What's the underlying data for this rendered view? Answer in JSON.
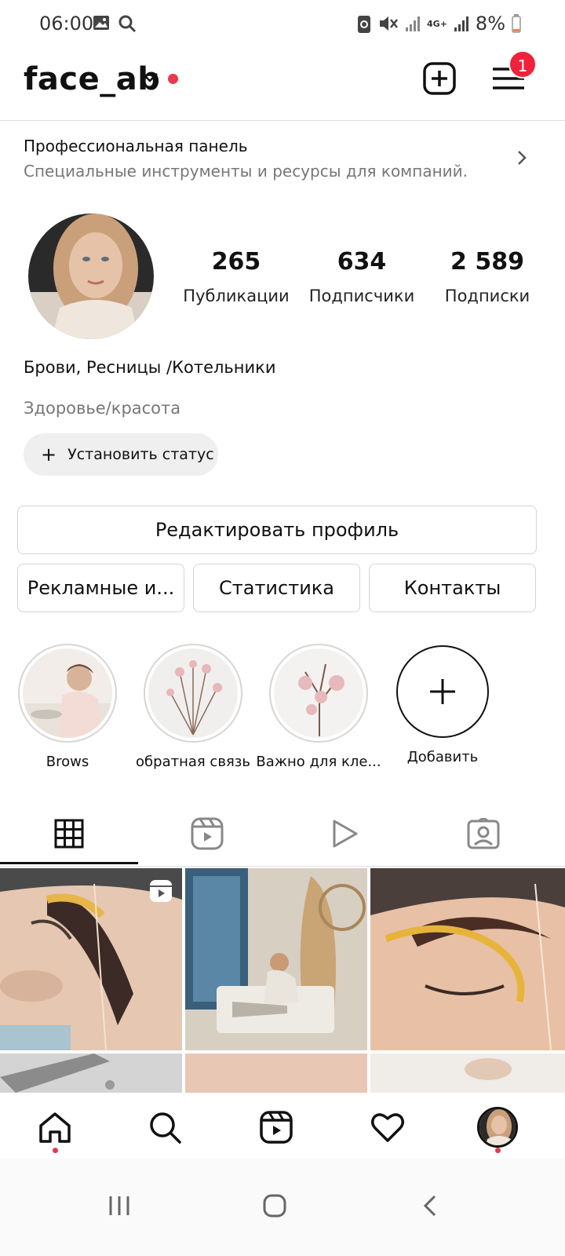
{
  "status_bar": {
    "time": "06:00",
    "battery": "8%",
    "network": "4G+"
  },
  "header": {
    "username": "face_ab",
    "menu_badge": "1"
  },
  "pro_panel": {
    "title": "Профессиональная панель",
    "subtitle": "Специальные инструменты и ресурсы для компаний."
  },
  "profile": {
    "stats": [
      {
        "value": "265",
        "label": "Публикации"
      },
      {
        "value": "634",
        "label": "Подписчики"
      },
      {
        "value": "2 589",
        "label": "Подписки"
      }
    ],
    "bio_name": "Брови, Ресницы /Котельники",
    "category": "Здоровье/красота",
    "status_button": "Установить статус"
  },
  "buttons": {
    "edit_profile": "Редактировать профиль",
    "ads": "Рекламные и...",
    "statistics": "Статистика",
    "contacts": "Контакты"
  },
  "highlights": [
    {
      "label": "Brows"
    },
    {
      "label": "обратная связь"
    },
    {
      "label": "Важно для кле..."
    },
    {
      "label": "Добавить"
    }
  ],
  "tabs": [
    "grid-icon",
    "reels-icon",
    "play-icon",
    "tagged-icon"
  ],
  "colors": {
    "accent_red": "#e8394d",
    "badge_red": "#f0213b"
  }
}
